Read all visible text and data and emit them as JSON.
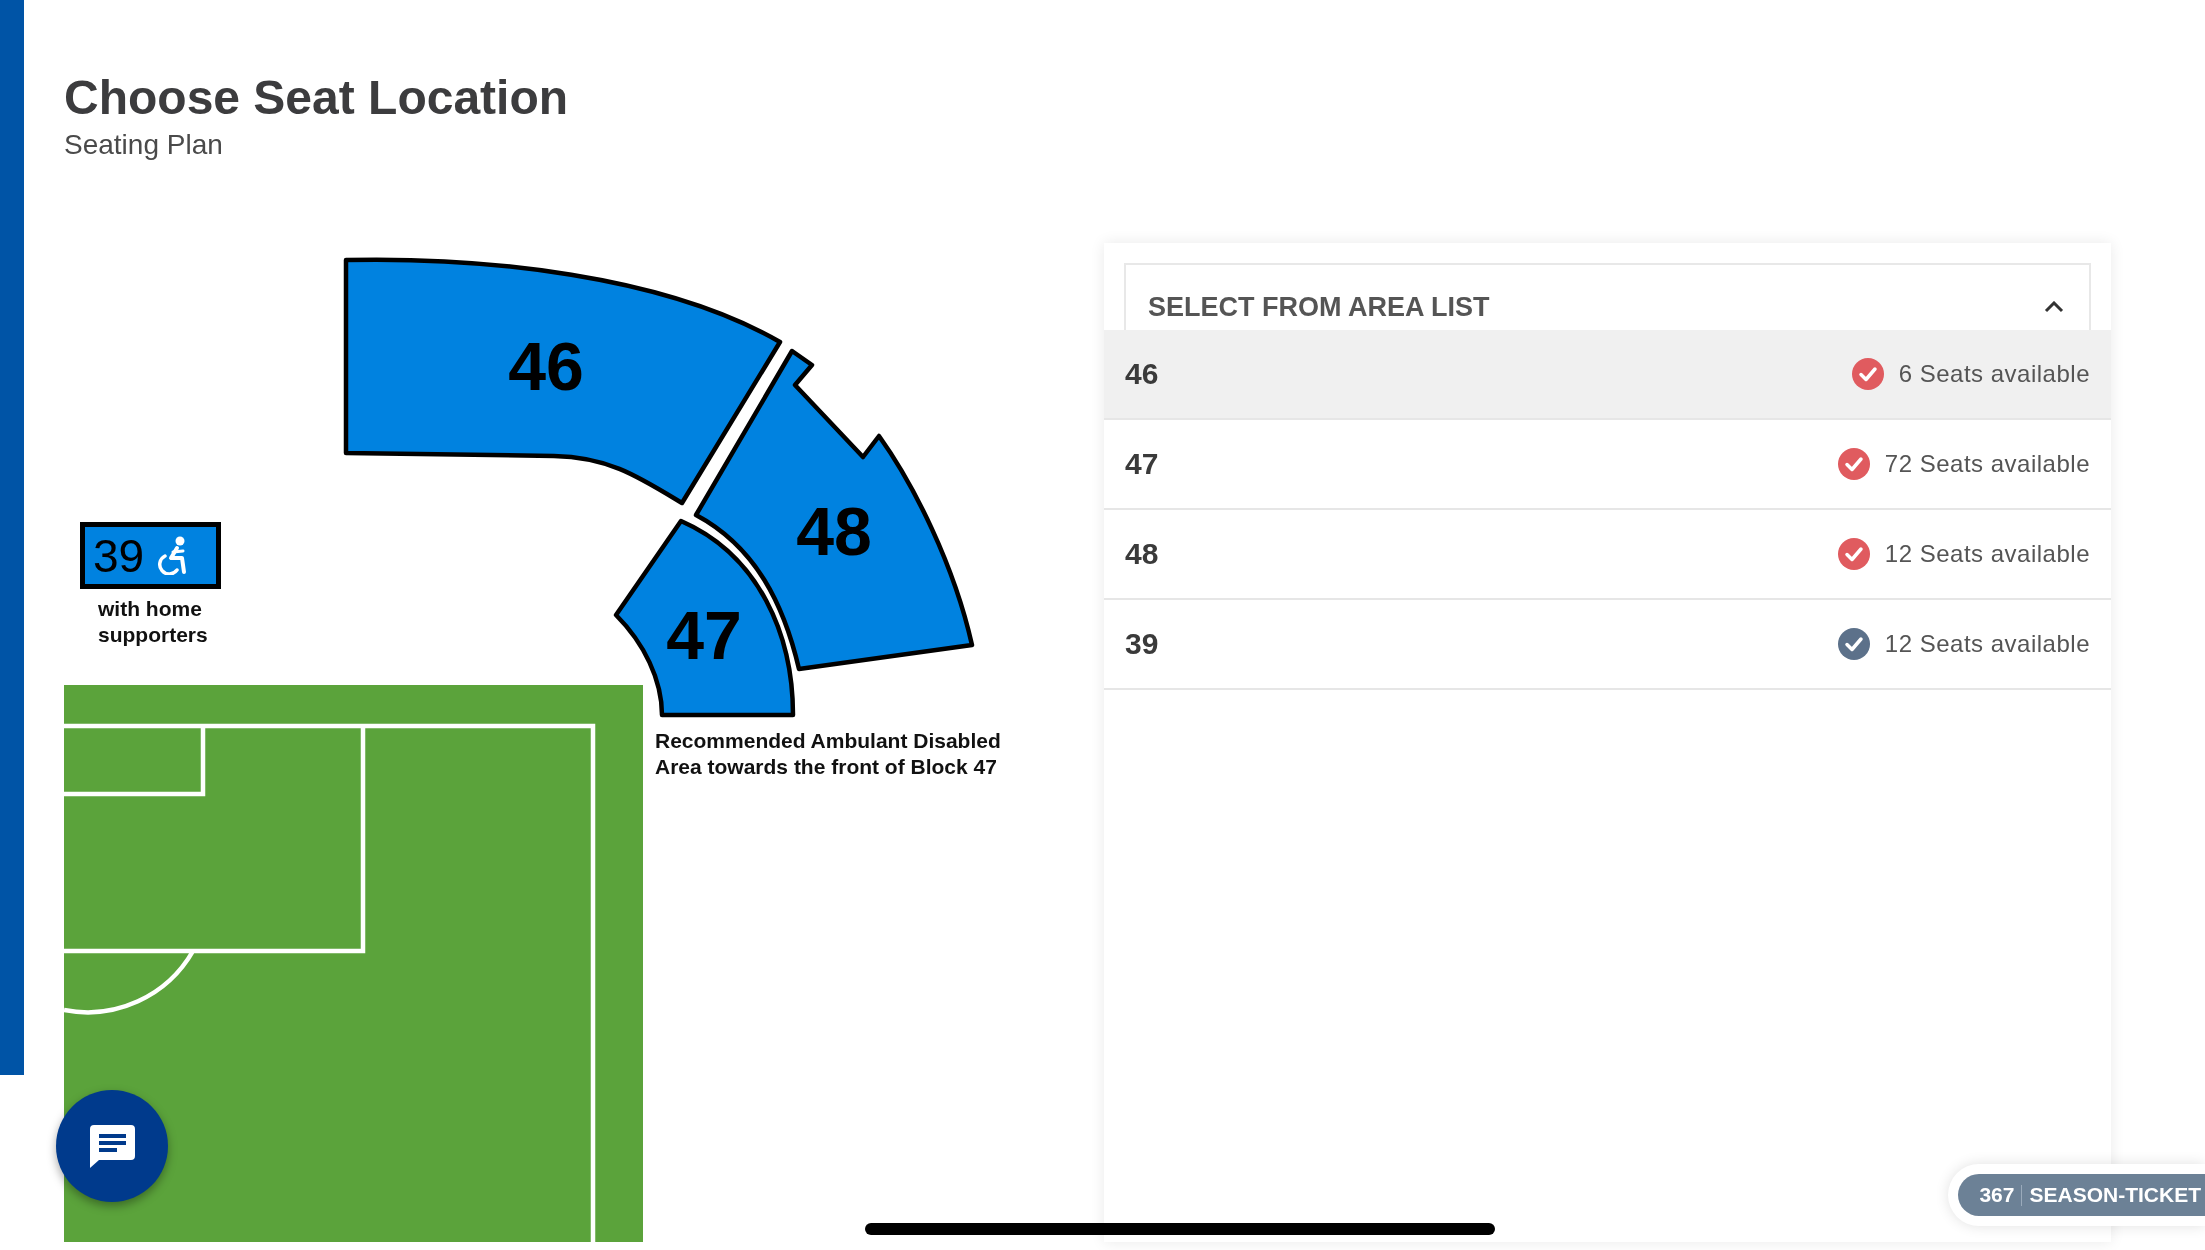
{
  "header": {
    "title": "Choose Seat Location",
    "subtitle": "Seating Plan"
  },
  "seat_map": {
    "blocks": [
      {
        "label": "46"
      },
      {
        "label": "48"
      },
      {
        "label": "47"
      }
    ],
    "accessible_block": {
      "label": "39",
      "note": "with home supporters"
    },
    "caption": "Recommended Ambulant Disabled Area towards the front of Block 47"
  },
  "area_list": {
    "title": "SELECT FROM AREA LIST",
    "expanded": true,
    "items": [
      {
        "label": "46",
        "seats": "6 Seats available",
        "color": "#e05b5f",
        "selected": true
      },
      {
        "label": "47",
        "seats": "72 Seats available",
        "color": "#e05b5f",
        "selected": false
      },
      {
        "label": "48",
        "seats": "12 Seats available",
        "color": "#e05b5f",
        "selected": false
      },
      {
        "label": "39",
        "seats": "12 Seats available",
        "color": "#5c718a",
        "selected": false
      }
    ]
  },
  "ticket_badge": {
    "count": "367",
    "type": "SEASON-TICKET"
  }
}
